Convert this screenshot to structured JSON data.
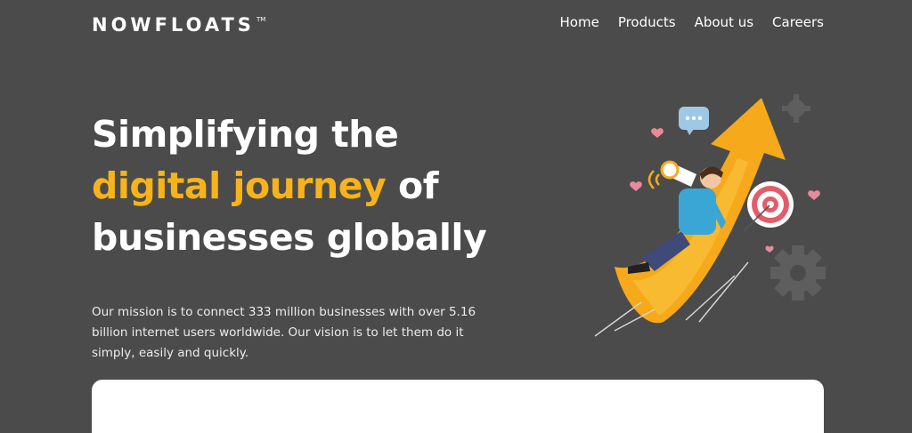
{
  "brand": {
    "name": "NOWFLOATS",
    "tm": "TM"
  },
  "nav": {
    "items": [
      "Home",
      "Products",
      "About us",
      "Careers"
    ]
  },
  "hero": {
    "line1": "Simplifying the",
    "line2_accent": "digital journey",
    "line2_rest": " of",
    "line3": "businesses globally",
    "mission": "Our mission is to connect 333 million businesses with over 5.16 billion internet users worldwide. Our vision is to let them do it simply, easily and quickly."
  },
  "colors": {
    "background": "#4b4b4b",
    "accent": "#f7b31b"
  }
}
